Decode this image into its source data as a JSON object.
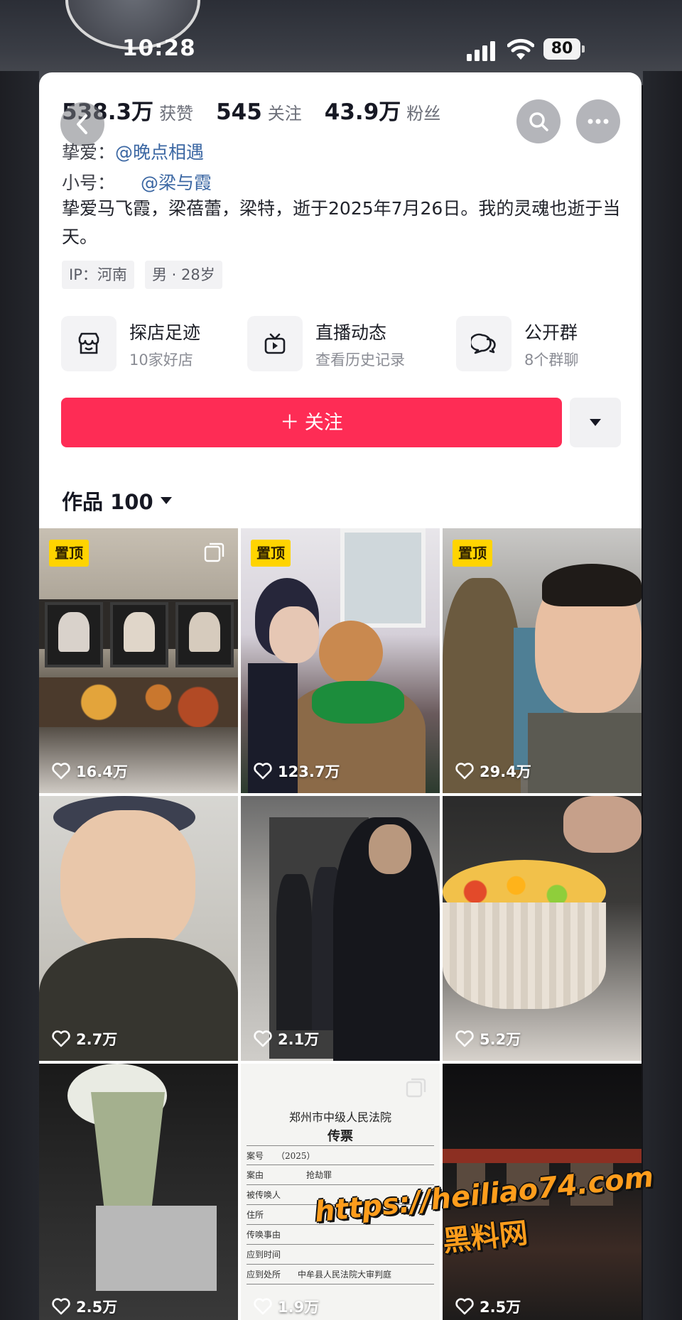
{
  "status_bar": {
    "time": "10:28",
    "battery": "80"
  },
  "profile": {
    "stats": [
      {
        "value": "538.3万",
        "label": "获赞"
      },
      {
        "value": "545",
        "label": "关注"
      },
      {
        "value": "43.9万",
        "label": "粉丝"
      }
    ],
    "relation_line": {
      "prefix": "挚爱：",
      "mention": "@晚点相遇"
    },
    "alt_account_line": {
      "prefix": "小号：",
      "mention": "@梁与霞"
    },
    "bio": "挚爱马飞霞，梁蓓蕾，梁特，逝于2025年7月26日。我的灵魂也逝于当天。",
    "tags": [
      "IP：河南",
      "男 · 28岁"
    ]
  },
  "features": [
    {
      "title": "探店足迹",
      "subtitle": "10家好店",
      "icon": "store-icon"
    },
    {
      "title": "直播动态",
      "subtitle": "查看历史记录",
      "icon": "tv-icon"
    },
    {
      "title": "公开群",
      "subtitle": "8个群聊",
      "icon": "group-chat-icon"
    }
  ],
  "follow_button": {
    "label": "＋ 关注"
  },
  "works_tab": {
    "label": "作品 100"
  },
  "videos": [
    {
      "pinned": true,
      "pin_label": "置顶",
      "likes": "16.4万",
      "multi_image": true
    },
    {
      "pinned": true,
      "pin_label": "置顶",
      "likes": "123.7万",
      "multi_image": false
    },
    {
      "pinned": true,
      "pin_label": "置顶",
      "likes": "29.4万",
      "multi_image": false
    },
    {
      "pinned": false,
      "likes": "2.7万"
    },
    {
      "pinned": false,
      "likes": "2.1万"
    },
    {
      "pinned": false,
      "likes": "5.2万"
    },
    {
      "pinned": false,
      "likes": "2.5万"
    },
    {
      "pinned": false,
      "likes": "1.9万",
      "multi_image": true,
      "document": {
        "court": "郑州市中级人民法院",
        "title": "传票",
        "case_no": "（2025）",
        "cause": "抢劫罪",
        "court_place": "中牟县人民法院大审判庭"
      }
    },
    {
      "pinned": false,
      "likes": "2.5万"
    }
  ],
  "watermark": {
    "url": "https://heiliao74.com",
    "name": "黑料网"
  },
  "colors": {
    "follow": "#fe2c55",
    "pin": "#ffd400",
    "mention": "#3b67a3",
    "watermark": "#ff9d1c"
  }
}
